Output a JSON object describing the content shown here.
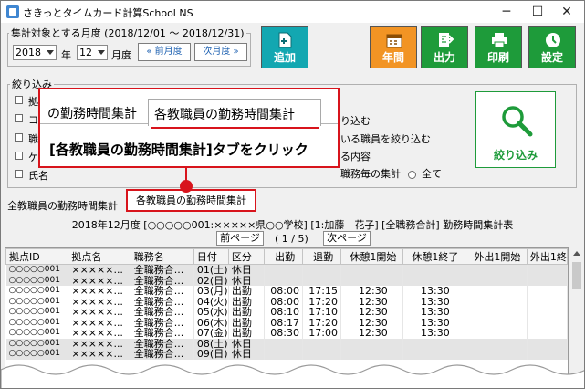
{
  "window": {
    "title": "さきっとタイムカード計算School NS",
    "minimize": "─",
    "maximize": "☐",
    "close": "✕"
  },
  "period": {
    "legend": "集計対象とする月度 (2018/12/01 〜 2018/12/31)",
    "year": "2018",
    "year_unit": "年",
    "month": "12",
    "month_unit": "月度",
    "prev_label": "« 前月度",
    "next_label": "次月度 »"
  },
  "buttons": {
    "add": "追加",
    "annual": "年間",
    "output": "出力",
    "print": "印刷",
    "settings": "設定",
    "filter": "絞り込み"
  },
  "filter": {
    "legend": "絞り込み",
    "chk1": "拠",
    "chk2": "コ",
    "chk3": "職",
    "chk4": "ケ",
    "chk5": "氏名",
    "text_narrow": "り込む",
    "text_narrow_staff": "いる職員を絞り込む",
    "text_content": "る内容",
    "text_per_job": "職務毎の集計",
    "radio_all": "全て"
  },
  "callout": {
    "tab1": "の勤務時間集計",
    "tab2": "各教職員の勤務時間集計",
    "instruction": "[各教職員の勤務時間集計]タブをクリック"
  },
  "tabs": {
    "all_staff": "全教職員の勤務時間集計",
    "each_staff": "各教職員の勤務時間集計"
  },
  "report": {
    "title": "2018年12月度 [○○○○○001:×××××県○○学校] [1:加藤　花子] [全職務合計] 勤務時間集計表",
    "prev_page": "前ページ",
    "page_info": "( 1 / 5)",
    "next_page": "次ページ"
  },
  "table": {
    "headers": [
      "拠点ID",
      "拠点名",
      "職務名",
      "日付",
      "区分",
      "出勤",
      "退勤",
      "休憩1開始",
      "休憩1終了",
      "外出1開始",
      "外出1終"
    ],
    "rows": [
      [
        "○○○○○001",
        "×××××...",
        "全職務合...",
        "01(土)",
        "休日",
        "",
        "",
        "",
        "",
        "",
        ""
      ],
      [
        "○○○○○001",
        "×××××...",
        "全職務合...",
        "02(日)",
        "休日",
        "",
        "",
        "",
        "",
        "",
        ""
      ],
      [
        "○○○○○001",
        "×××××...",
        "全職務合...",
        "03(月)",
        "出勤",
        "08:00",
        "17:15",
        "12:30",
        "13:30",
        "",
        ""
      ],
      [
        "○○○○○001",
        "×××××...",
        "全職務合...",
        "04(火)",
        "出勤",
        "08:00",
        "17:20",
        "12:30",
        "13:30",
        "",
        ""
      ],
      [
        "○○○○○001",
        "×××××...",
        "全職務合...",
        "05(水)",
        "出勤",
        "08:10",
        "17:10",
        "12:30",
        "13:30",
        "",
        ""
      ],
      [
        "○○○○○001",
        "×××××...",
        "全職務合...",
        "06(木)",
        "出勤",
        "08:17",
        "17:20",
        "12:30",
        "13:30",
        "",
        ""
      ],
      [
        "○○○○○001",
        "×××××...",
        "全職務合...",
        "07(金)",
        "出勤",
        "08:30",
        "17:00",
        "12:30",
        "13:30",
        "",
        ""
      ],
      [
        "○○○○○001",
        "×××××...",
        "全職務合...",
        "08(土)",
        "休日",
        "",
        "",
        "",
        "",
        "",
        ""
      ],
      [
        "○○○○○001",
        "×××××...",
        "全職務合...",
        "09(日)",
        "休日",
        "",
        "",
        "",
        "",
        "",
        ""
      ]
    ]
  },
  "colors": {
    "teal": "#13a7b1",
    "orange": "#f29424",
    "green": "#1e9b3a",
    "callout_red": "#d8141c"
  },
  "icons": {
    "add": "add-document-icon",
    "annual": "calendar-icon",
    "output": "export-icon",
    "print": "printer-icon",
    "settings": "clock-icon",
    "filter": "magnifier-icon"
  }
}
